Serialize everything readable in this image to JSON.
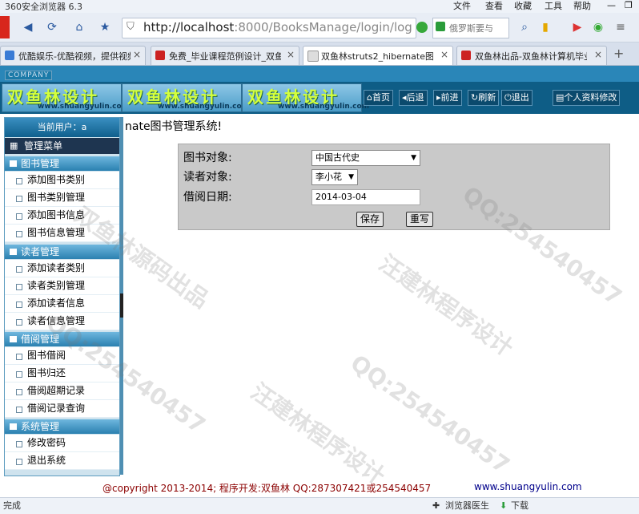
{
  "browser": {
    "title": "360安全浏览器 6.3",
    "menu": [
      "文件",
      "查看",
      "收藏",
      "工具",
      "帮助"
    ],
    "address_host": "http://localhost",
    "address_rest": ":8000/BooksManage/login/log",
    "search_placeholder": "俄罗斯要与",
    "tabs": [
      {
        "label": "优酷娱乐-优酷视频，提供视频",
        "color": "#3a7bd5"
      },
      {
        "label": "免费_毕业课程范例设计_双鱼林",
        "color": "#cc2222"
      },
      {
        "label": "双鱼林struts2_hibernate图书",
        "color": "#888888"
      },
      {
        "label": "双鱼林出品-双鱼林计算机毕业",
        "color": "#cc2222"
      }
    ],
    "new_tab": "+",
    "status_left": "完成",
    "status_doctor": "浏览器医生",
    "status_download": "下载"
  },
  "site": {
    "company": "COMPANY",
    "banner_text": "双鱼林设计",
    "banner_url": "www.shuangyulin.com",
    "topnav": [
      "首页",
      "后退",
      "前进",
      "刷新",
      "退出",
      "个人资料修改"
    ]
  },
  "sidebar": {
    "user_label": "当前用户：a",
    "menu_title": "管理菜单",
    "sections": [
      {
        "title": "图书管理",
        "items": [
          "添加图书类别",
          "图书类别管理",
          "添加图书信息",
          "图书信息管理"
        ]
      },
      {
        "title": "读者管理",
        "items": [
          "添加读者类别",
          "读者类别管理",
          "添加读者信息",
          "读者信息管理"
        ]
      },
      {
        "title": "借阅管理",
        "items": [
          "图书借阅",
          "图书归还",
          "借阅超期记录",
          "借阅记录查询"
        ]
      },
      {
        "title": "系统管理",
        "items": [
          "修改密码",
          "退出系统"
        ]
      }
    ]
  },
  "main": {
    "page_title": "nate图书管理系统!",
    "form": {
      "book_label": "图书对象:",
      "book_value": "中国古代史",
      "reader_label": "读者对象:",
      "reader_value": "李小花",
      "date_label": "借阅日期:",
      "date_value": "2014-03-04",
      "save": "保存",
      "reset": "重写"
    }
  },
  "footer": {
    "copyright": "@copyright 2013-2014; 程序开发:双鱼林  QQ:287307421或254540457",
    "site": "www.shuangyulin.com"
  },
  "watermarks": [
    "汪建林程序设计",
    "QQ:254540457",
    "双鱼林源码出品",
    "QQ:254540457",
    "汪建林程序设计",
    "QQ:254540457"
  ]
}
